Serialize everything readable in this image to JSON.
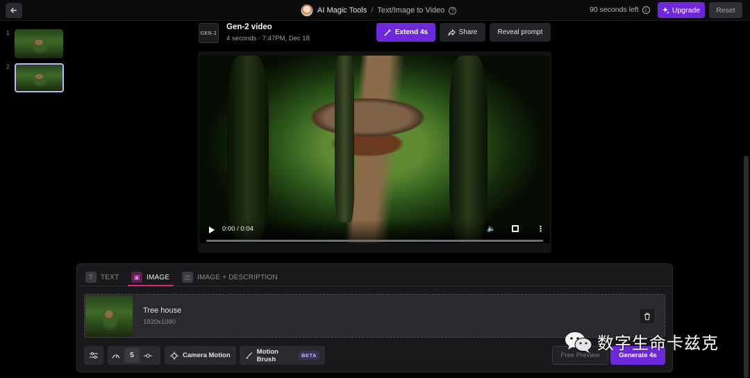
{
  "topbar": {
    "app_name": "AI Magic Tools",
    "separator": "/",
    "page_name": "Text/Image to Video",
    "time_left": "90 seconds left",
    "upgrade_label": "Upgrade",
    "reset_label": "Reset"
  },
  "thumbnails": [
    {
      "index": "1",
      "selected": false
    },
    {
      "index": "2",
      "selected": true
    }
  ],
  "video_header": {
    "logo_text": "GEN-2",
    "title": "Gen-2 video",
    "subtitle": "4 seconds · 7:47PM, Dec 18",
    "extend_label": "Extend 4s",
    "share_label": "Share",
    "reveal_label": "Reveal prompt"
  },
  "player": {
    "time": "0:00 / 0:04",
    "progress": 0
  },
  "panel": {
    "tabs": [
      {
        "label": "TEXT",
        "icon": "text-icon",
        "active": false
      },
      {
        "label": "IMAGE",
        "icon": "image-icon",
        "active": true
      },
      {
        "label": "IMAGE + DESCRIPTION",
        "icon": "image-description-icon",
        "active": false
      }
    ],
    "image": {
      "name": "Tree house",
      "dimensions": "1920x1080"
    },
    "tools": {
      "speed_value": "5",
      "camera_motion_label": "Camera Motion",
      "motion_brush_label": "Motion Brush",
      "beta_label": "BETA",
      "free_preview_label": "Free Preview",
      "generate_label": "Generate 4s"
    }
  },
  "watermark": {
    "text": "数字生命卡兹克"
  },
  "colors": {
    "accent": "#6d28d9",
    "tab_active": "#db2777",
    "panel_bg": "#19191c"
  }
}
